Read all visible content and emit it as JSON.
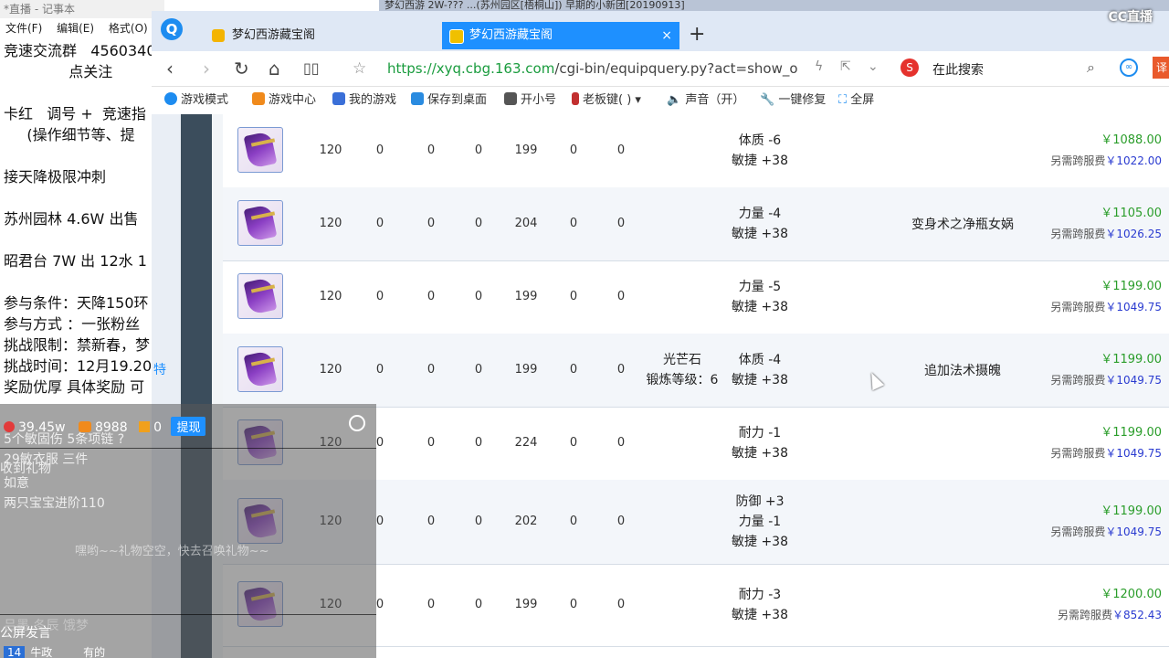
{
  "notepad": {
    "title": "*直播 - 记事本",
    "menu": [
      "文件(F)",
      "编辑(E)",
      "格式(O)"
    ],
    "lines": [
      "竞速交流群   4560340",
      "              点关注",
      "",
      "卡红   调号 +  竞速指",
      "     (操作细节等、提",
      "",
      "接天降极限冲刺",
      "",
      "苏州园林 4.6W 出售",
      "",
      "昭君台 7W 出 12水 1",
      "",
      "参与条件：天降150环",
      "参与方式 ：一张粉丝",
      "挑战限制：禁新春，梦",
      "挑战时间：12月19.20",
      "奖励优厚 具体奖励 可"
    ]
  },
  "bg_window_title": "梦幻西游  2W-??? ...(苏州园区[梧桐山])  早期的小新团[20190913]",
  "browser": {
    "logo": "Q",
    "tabs": [
      {
        "label": "梦幻西游藏宝阁",
        "active": false
      },
      {
        "label": "梦幻西游藏宝阁",
        "active": true,
        "close": "×"
      }
    ],
    "new_tab": "+",
    "url_host": "https://xyq.cbg.163.com",
    "url_path": "/cgi-bin/equipquery.py?act=show_over",
    "search_engine": "S",
    "search_placeholder": "在此搜索",
    "ext2": "译",
    "bookmarks": [
      "游戏模式",
      "游戏中心",
      "我的游戏",
      "保存到桌面",
      "开小号",
      "老板键(  )",
      "声音（开）",
      "一键修复",
      "全屏"
    ]
  },
  "rows": [
    {
      "cols": [
        "120",
        "0",
        "0",
        "0",
        "199",
        "0",
        "0"
      ],
      "gem": [],
      "attrs": [
        "体质 -6",
        "敏捷 +38"
      ],
      "effect": "",
      "price": "￥1088.00",
      "fee_label": "另需跨服费",
      "fee": "￥1022.00"
    },
    {
      "cols": [
        "120",
        "0",
        "0",
        "0",
        "204",
        "0",
        "0"
      ],
      "gem": [],
      "attrs": [
        "力量 -4",
        "敏捷 +38"
      ],
      "effect": "变身术之净瓶女娲",
      "price": "￥1105.00",
      "fee_label": "另需跨服费",
      "fee": "￥1026.25"
    },
    {
      "cols": [
        "120",
        "0",
        "0",
        "0",
        "199",
        "0",
        "0"
      ],
      "gem": [],
      "attrs": [
        "力量 -5",
        "敏捷 +38"
      ],
      "effect": "",
      "price": "￥1199.00",
      "fee_label": "另需跨服费",
      "fee": "￥1049.75"
    },
    {
      "cols": [
        "120",
        "0",
        "0",
        "0",
        "199",
        "0",
        "0"
      ],
      "gem": [
        "光芒石",
        "锻炼等级：6"
      ],
      "attrs": [
        "体质 -4",
        "敏捷 +38"
      ],
      "effect": "追加法术摄魄",
      "price": "￥1199.00",
      "fee_label": "另需跨服费",
      "fee": "￥1049.75"
    },
    {
      "cols": [
        "120",
        "0",
        "0",
        "0",
        "224",
        "0",
        "0"
      ],
      "gem": [],
      "attrs": [
        "耐力 -1",
        "敏捷 +38"
      ],
      "effect": "",
      "price": "￥1199.00",
      "fee_label": "另需跨服费",
      "fee": "￥1049.75"
    },
    {
      "cols": [
        "120",
        "0",
        "0",
        "0",
        "202",
        "0",
        "0"
      ],
      "gem": [],
      "attrs": [
        "防御 +3",
        "力量 -1",
        "敏捷 +38"
      ],
      "effect": "",
      "price": "￥1199.00",
      "fee_label": "另需跨服费",
      "fee": "￥1049.75"
    },
    {
      "cols": [
        "120",
        "0",
        "0",
        "0",
        "199",
        "0",
        "0"
      ],
      "gem": [],
      "attrs": [
        "耐力 -3",
        "敏捷 +38"
      ],
      "effect": "",
      "price": "￥1200.00",
      "fee_label": "另需跨服费",
      "fee": "￥852.43"
    }
  ],
  "overlay": {
    "viewers": "39.45w",
    "fans": "8988",
    "gifts": "0",
    "withdraw": "提现",
    "lines": [
      "5个敏固伤  5条项链 ?",
      "29敏衣服 三件",
      "收到礼物",
      "如意",
      "两只宝宝进阶110"
    ],
    "gift_notice": "嘿哟~~礼物空空，快去召唤礼物~~",
    "faint_lines": [
      "吕墨 冬辰 饿梦"
    ],
    "chat_label": "公屏发言",
    "chat_level": "14",
    "chat_user": "牛政",
    "chat_text": "有的"
  },
  "side_char": "特",
  "cc_logo": "CC直播"
}
